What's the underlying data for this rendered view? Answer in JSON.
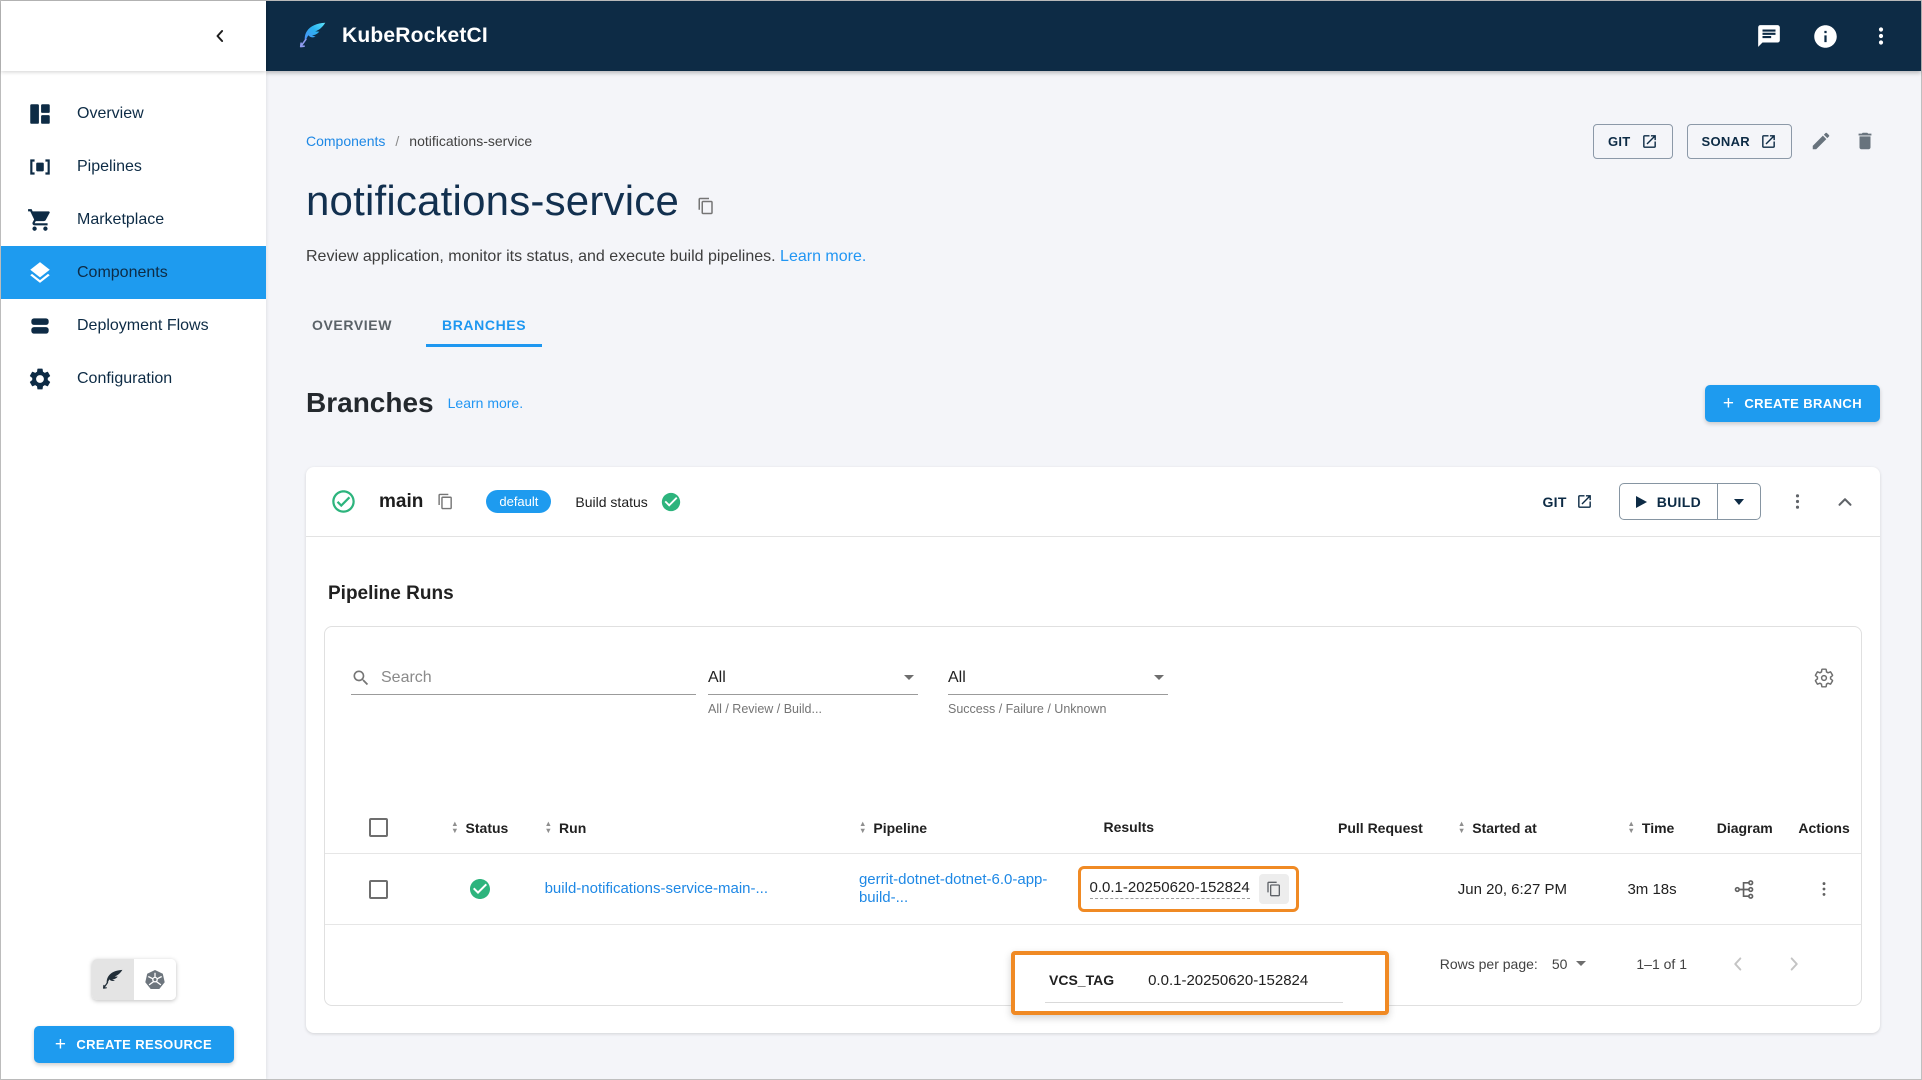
{
  "app": {
    "title": "KubeRocketCI"
  },
  "sidebar": {
    "items": [
      {
        "label": "Overview"
      },
      {
        "label": "Pipelines"
      },
      {
        "label": "Marketplace"
      },
      {
        "label": "Components"
      },
      {
        "label": "Deployment Flows"
      },
      {
        "label": "Configuration"
      }
    ],
    "create_resource_label": "CREATE RESOURCE"
  },
  "page": {
    "breadcrumb_root": "Components",
    "breadcrumb_separator": "/",
    "breadcrumb_current": "notifications-service",
    "title": "notifications-service",
    "description": "Review application, monitor its status, and execute build pipelines.",
    "learn_more": "Learn more."
  },
  "header_actions": {
    "git_label": "GIT",
    "sonar_label": "SONAR"
  },
  "tabs": {
    "overview": "OVERVIEW",
    "branches": "BRANCHES"
  },
  "branches_section": {
    "heading": "Branches",
    "learn_more": "Learn more.",
    "create_button": "CREATE BRANCH"
  },
  "branch": {
    "name": "main",
    "default_chip": "default",
    "build_status_label": "Build status",
    "git_label": "GIT",
    "build_label": "BUILD"
  },
  "pipeline_runs": {
    "heading": "Pipeline Runs",
    "search_placeholder": "Search",
    "filter_type": {
      "value": "All",
      "helper": "All / Review / Build..."
    },
    "filter_status": {
      "value": "All",
      "helper": "Success / Failure / Unknown"
    }
  },
  "table": {
    "columns": [
      "Status",
      "Run",
      "Pipeline",
      "Results",
      "Pull Request",
      "Started at",
      "Time",
      "Diagram",
      "Actions"
    ],
    "row": {
      "run": "build-notifications-service-main-...",
      "pipeline": "gerrit-dotnet-dotnet-6.0-app-build-...",
      "results": "0.0.1-20250620-152824",
      "pull_request": "",
      "started_at": "Jun 20, 6:27 PM",
      "time": "3m 18s"
    }
  },
  "tooltip": {
    "label": "VCS_TAG",
    "value": "0.0.1-20250620-152824"
  },
  "pagination": {
    "rows_per_page_label": "Rows per page:",
    "rows_per_page_value": "50",
    "range": "1–1 of 1"
  },
  "colors": {
    "topbar_navy": "#0d2b45",
    "accent_blue": "#1e9bef",
    "link_blue": "#1e88e5",
    "success_green": "#2db47d",
    "annotation_orange": "#f08a24",
    "page_background": "#f4f5f9"
  }
}
